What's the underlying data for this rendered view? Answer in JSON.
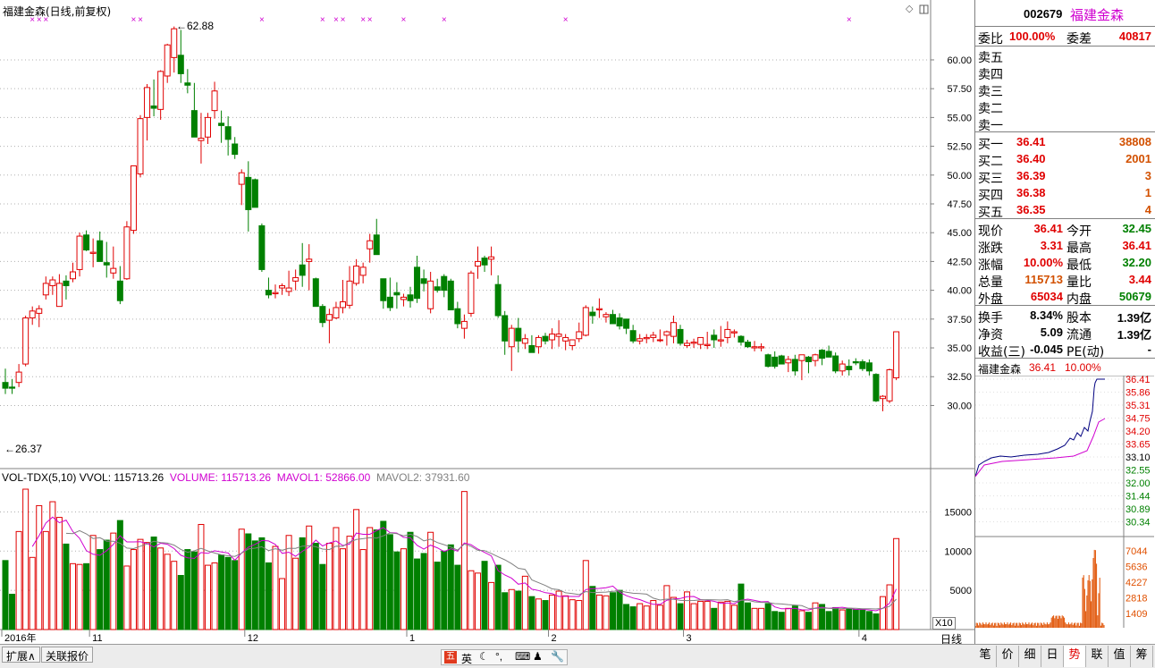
{
  "main_chart": {
    "title": "福建金森(日线,前复权)",
    "high_label": "62.88",
    "low_label": "26.37",
    "price_axis": [
      "60.00",
      "57.50",
      "55.00",
      "52.50",
      "50.00",
      "47.50",
      "45.00",
      "42.50",
      "40.00",
      "37.50",
      "35.00",
      "32.50",
      "30.00"
    ],
    "price_axis_values": [
      60.0,
      57.5,
      55.0,
      52.5,
      50.0,
      47.5,
      45.0,
      42.5,
      40.0,
      37.5,
      35.0,
      32.5,
      30.0
    ],
    "price_range": [
      25.3,
      63.8
    ],
    "corner_glyph": "◇"
  },
  "volume_chart": {
    "label_indicator": "VOL-TDX(5,10)",
    "label_vvol": "VVOL: 115713.26",
    "label_volume": "VOLUME: 115713.26",
    "label_mavol1": "MAVOL1: 52866.00",
    "label_mavol2": "MAVOL2: 37931.60",
    "axis": [
      "15000",
      "10000",
      "5000"
    ],
    "axis_values": [
      15000,
      10000,
      5000
    ],
    "unit": "X10"
  },
  "date_axis": [
    "2016年",
    "11",
    "12",
    "1",
    "2",
    "3",
    "4"
  ],
  "period_label": "日线",
  "quote": {
    "code": "002679",
    "name": "福建金森",
    "weibi_label": "委比",
    "weibi": "100.00%",
    "weicha_label": "委差",
    "weicha": "40817",
    "sells": [
      {
        "label": "卖五"
      },
      {
        "label": "卖四"
      },
      {
        "label": "卖三"
      },
      {
        "label": "卖二"
      },
      {
        "label": "卖一"
      }
    ],
    "buys": [
      {
        "label": "买一",
        "price": "36.41",
        "vol": "38808"
      },
      {
        "label": "买二",
        "price": "36.40",
        "vol": "2001"
      },
      {
        "label": "买三",
        "price": "36.39",
        "vol": "3"
      },
      {
        "label": "买四",
        "price": "36.38",
        "vol": "1"
      },
      {
        "label": "买五",
        "price": "36.35",
        "vol": "4"
      }
    ],
    "stats": [
      {
        "l1": "现价",
        "v1": "36.41",
        "c1": "red",
        "l2": "今开",
        "v2": "32.45",
        "c2": "green"
      },
      {
        "l1": "涨跌",
        "v1": "3.31",
        "c1": "red",
        "l2": "最高",
        "v2": "36.41",
        "c2": "red"
      },
      {
        "l1": "涨幅",
        "v1": "10.00%",
        "c1": "red",
        "l2": "最低",
        "v2": "32.20",
        "c2": "green"
      },
      {
        "l1": "总量",
        "v1": "115713",
        "c1": "orange",
        "l2": "量比",
        "v2": "3.44",
        "c2": "red"
      },
      {
        "l1": "外盘",
        "v1": "65034",
        "c1": "red",
        "l2": "内盘",
        "v2": "50679",
        "c2": "green"
      }
    ],
    "fund": [
      {
        "l1": "换手",
        "v1": "8.34%",
        "l2": "股本",
        "v2": "1.39亿"
      },
      {
        "l1": "净资",
        "v1": "5.09",
        "l2": "流通",
        "v2": "1.39亿"
      },
      {
        "l1": "收益(三)",
        "v1": "-0.045",
        "l2": "PE(动)",
        "v2": "-"
      }
    ]
  },
  "intraday": {
    "name": "福建金森",
    "price": "36.41",
    "pct": "10.00%",
    "price_axis": [
      "36.41",
      "35.86",
      "35.31",
      "34.75",
      "34.20",
      "33.65",
      "33.10",
      "32.55",
      "32.00",
      "31.44",
      "30.89",
      "30.34"
    ],
    "vol_axis": [
      "7044",
      "5636",
      "4227",
      "2818",
      "1409"
    ]
  },
  "toolbar": {
    "expand": "扩展∧",
    "related": "关联报价",
    "ime": "英"
  },
  "right_tabs": [
    "笔",
    "价",
    "细",
    "日",
    "势",
    "联",
    "值",
    "筹"
  ],
  "colors": {
    "up": "#e00000",
    "down": "#008000",
    "ma1": "#d000d0",
    "ma2": "#808080",
    "intraday_price": "#000080",
    "intraday_avg": "#d000d0",
    "intraday_vol": "#e05000"
  },
  "chart_data": {
    "type": "candlestick",
    "ohlc": [
      [
        32.0,
        33.2,
        31.0,
        31.5
      ],
      [
        31.6,
        32.3,
        31.0,
        31.5
      ],
      [
        32.0,
        33.6,
        31.6,
        32.9
      ],
      [
        33.6,
        37.8,
        33.4,
        37.6
      ],
      [
        37.6,
        38.6,
        37.0,
        38.2
      ],
      [
        38.0,
        38.7,
        36.8,
        38.4
      ],
      [
        39.6,
        41.2,
        39.2,
        40.6
      ],
      [
        40.4,
        41.2,
        39.6,
        40.9
      ],
      [
        38.6,
        41.4,
        38.6,
        40.6
      ],
      [
        40.8,
        41.3,
        39.2,
        40.4
      ],
      [
        41.0,
        42.4,
        40.7,
        41.6
      ],
      [
        41.8,
        45.0,
        41.2,
        44.7
      ],
      [
        44.8,
        45.2,
        43.4,
        43.5
      ],
      [
        43.2,
        44.5,
        42.0,
        43.3
      ],
      [
        44.3,
        45.1,
        42.6,
        42.5
      ],
      [
        42.4,
        44.2,
        41.1,
        42.2
      ],
      [
        41.5,
        43.8,
        41.0,
        41.9
      ],
      [
        40.8,
        42.1,
        38.8,
        39.1
      ],
      [
        41.0,
        46.0,
        40.9,
        45.5
      ],
      [
        45.2,
        50.8,
        44.9,
        50.8
      ],
      [
        50.1,
        55.2,
        49.8,
        54.9
      ],
      [
        55.0,
        57.9,
        53.0,
        57.6
      ],
      [
        56.0,
        58.3,
        55.1,
        55.8
      ],
      [
        55.7,
        59.1,
        54.8,
        59.0
      ],
      [
        58.6,
        61.4,
        58.0,
        61.3
      ],
      [
        60.2,
        62.9,
        58.9,
        62.7
      ],
      [
        60.4,
        62.6,
        58.0,
        58.8
      ],
      [
        58.0,
        59.2,
        57.1,
        57.8
      ],
      [
        55.6,
        58.0,
        54.2,
        53.3
      ],
      [
        53.0,
        55.4,
        51.0,
        53.2
      ],
      [
        53.3,
        55.4,
        52.7,
        55.0
      ],
      [
        55.6,
        58.1,
        54.9,
        57.3
      ],
      [
        54.5,
        55.6,
        52.8,
        54.3
      ],
      [
        54.2,
        55.1,
        51.7,
        53.1
      ],
      [
        52.7,
        53.3,
        51.4,
        51.8
      ],
      [
        49.2,
        50.5,
        47.4,
        50.2
      ],
      [
        49.8,
        51.2,
        45.1,
        47.0
      ],
      [
        49.6,
        49.7,
        47.3,
        47.2
      ],
      [
        45.6,
        45.8,
        41.6,
        41.8
      ],
      [
        40.0,
        41.1,
        39.3,
        39.6
      ],
      [
        39.7,
        40.5,
        39.3,
        39.8
      ],
      [
        40.2,
        40.6,
        39.6,
        40.4
      ],
      [
        39.9,
        41.7,
        39.5,
        40.2
      ],
      [
        40.8,
        41.8,
        40.0,
        41.1
      ],
      [
        42.2,
        44.1,
        40.3,
        41.3
      ],
      [
        42.5,
        44.0,
        40.0,
        42.7
      ],
      [
        41.0,
        41.1,
        38.6,
        38.6
      ],
      [
        38.6,
        38.8,
        36.8,
        37.2
      ],
      [
        37.4,
        38.4,
        35.4,
        37.9
      ],
      [
        37.6,
        39.0,
        37.5,
        38.5
      ],
      [
        38.5,
        40.9,
        38.0,
        39.0
      ],
      [
        38.7,
        42.1,
        38.4,
        40.8
      ],
      [
        40.6,
        42.7,
        40.4,
        42.1
      ],
      [
        41.3,
        42.4,
        40.6,
        42.0
      ],
      [
        43.6,
        44.9,
        42.4,
        44.3
      ],
      [
        44.8,
        46.2,
        43.4,
        43.1
      ],
      [
        41.0,
        41.0,
        38.4,
        39.1
      ],
      [
        39.4,
        41.1,
        38.2,
        38.5
      ],
      [
        39.8,
        40.7,
        38.4,
        39.6
      ],
      [
        39.2,
        39.7,
        38.6,
        39.4
      ],
      [
        39.6,
        40.3,
        38.5,
        39.1
      ],
      [
        42.0,
        43.0,
        38.9,
        39.3
      ],
      [
        41.0,
        41.8,
        39.9,
        40.6
      ],
      [
        38.4,
        41.6,
        38.0,
        40.8
      ],
      [
        40.3,
        41.0,
        39.8,
        40.0
      ],
      [
        41.2,
        41.4,
        39.4,
        40.0
      ],
      [
        40.8,
        41.0,
        38.8,
        38.3
      ],
      [
        38.4,
        39.0,
        36.7,
        37.1
      ],
      [
        36.7,
        37.9,
        35.8,
        37.3
      ],
      [
        38.0,
        41.7,
        37.7,
        41.5
      ],
      [
        42.1,
        43.8,
        41.0,
        42.5
      ],
      [
        42.8,
        43.0,
        41.6,
        42.2
      ],
      [
        42.7,
        43.8,
        41.3,
        42.9
      ],
      [
        40.5,
        41.3,
        37.6,
        37.8
      ],
      [
        37.8,
        38.2,
        34.4,
        35.6
      ],
      [
        35.1,
        37.0,
        33.0,
        36.7
      ],
      [
        36.7,
        37.6,
        34.6,
        35.6
      ],
      [
        35.4,
        36.2,
        34.9,
        35.8
      ],
      [
        35.2,
        36.1,
        34.9,
        34.6
      ],
      [
        35.1,
        36.1,
        34.5,
        35.9
      ],
      [
        36.0,
        36.3,
        35.3,
        35.6
      ],
      [
        35.7,
        36.7,
        34.9,
        36.2
      ],
      [
        36.0,
        37.4,
        35.1,
        36.2
      ],
      [
        35.6,
        36.2,
        34.8,
        35.9
      ],
      [
        35.2,
        35.6,
        34.8,
        35.7
      ],
      [
        35.8,
        37.2,
        35.5,
        36.4
      ],
      [
        36.1,
        38.7,
        36.0,
        38.5
      ],
      [
        38.1,
        38.6,
        37.1,
        37.8
      ],
      [
        38.3,
        39.3,
        37.6,
        38.4
      ],
      [
        37.7,
        38.1,
        37.2,
        37.9
      ],
      [
        37.9,
        38.3,
        37.1,
        37.1
      ],
      [
        37.6,
        38.0,
        36.6,
        36.9
      ],
      [
        37.5,
        37.5,
        36.2,
        36.7
      ],
      [
        36.5,
        37.0,
        35.4,
        35.6
      ],
      [
        35.6,
        36.2,
        35.3,
        35.8
      ],
      [
        35.8,
        36.2,
        35.4,
        35.9
      ],
      [
        35.9,
        36.4,
        35.5,
        36.1
      ],
      [
        35.7,
        36.6,
        35.5,
        35.7
      ],
      [
        36.1,
        36.5,
        35.2,
        36.4
      ],
      [
        36.0,
        37.8,
        35.4,
        37.2
      ],
      [
        36.6,
        37.0,
        35.2,
        35.4
      ],
      [
        35.2,
        35.7,
        35.0,
        35.4
      ],
      [
        35.4,
        35.8,
        35.0,
        35.5
      ],
      [
        35.3,
        35.6,
        34.9,
        35.9
      ],
      [
        35.2,
        36.4,
        34.9,
        35.3
      ],
      [
        36.1,
        36.6,
        35.0,
        35.7
      ],
      [
        35.6,
        36.9,
        35.1,
        35.7
      ],
      [
        35.9,
        37.3,
        35.4,
        36.6
      ],
      [
        36.3,
        36.6,
        35.9,
        36.4
      ],
      [
        36.0,
        36.1,
        35.2,
        35.5
      ],
      [
        35.5,
        35.7,
        35.0,
        35.1
      ],
      [
        35.0,
        35.6,
        34.7,
        35.1
      ],
      [
        35.0,
        35.4,
        34.7,
        35.1
      ],
      [
        34.4,
        34.5,
        33.3,
        33.4
      ],
      [
        34.2,
        34.7,
        33.2,
        33.4
      ],
      [
        34.3,
        34.4,
        33.6,
        33.6
      ],
      [
        33.7,
        34.3,
        32.9,
        34.0
      ],
      [
        34.0,
        34.4,
        32.6,
        33.0
      ],
      [
        33.9,
        34.2,
        32.2,
        34.4
      ],
      [
        34.2,
        34.3,
        32.8,
        33.8
      ],
      [
        33.9,
        34.5,
        33.4,
        34.4
      ],
      [
        34.8,
        34.9,
        33.5,
        34.1
      ],
      [
        34.7,
        35.2,
        34.2,
        34.2
      ],
      [
        34.3,
        34.6,
        32.8,
        33.0
      ],
      [
        33.0,
        33.9,
        32.6,
        33.6
      ],
      [
        33.4,
        34.0,
        32.6,
        33.1
      ],
      [
        33.8,
        34.1,
        33.5,
        33.7
      ],
      [
        33.8,
        34.0,
        33.0,
        33.2
      ],
      [
        33.7,
        34.0,
        32.6,
        33.0
      ],
      [
        32.7,
        32.8,
        30.3,
        30.4
      ],
      [
        30.6,
        30.9,
        29.5,
        30.8
      ],
      [
        30.4,
        33.2,
        30.2,
        33.1
      ],
      [
        32.4,
        36.4,
        32.2,
        36.4
      ]
    ],
    "volume": [
      8800,
      4500,
      12500,
      17900,
      9200,
      15800,
      12500,
      16300,
      14300,
      10900,
      8400,
      8300,
      8400,
      12000,
      10200,
      11400,
      12300,
      13900,
      8100,
      10200,
      11500,
      11100,
      11800,
      10400,
      9600,
      8700,
      6900,
      10200,
      9900,
      13400,
      8200,
      8500,
      9500,
      9200,
      8800,
      12800,
      12200,
      11300,
      11700,
      8500,
      10600,
      6500,
      12000,
      9100,
      11700,
      13200,
      11000,
      8300,
      11000,
      13000,
      10300,
      11900,
      15300,
      10200,
      13000,
      12700,
      13800,
      12100,
      9900,
      10300,
      12400,
      9000,
      9700,
      12400,
      8600,
      10000,
      10800,
      8200,
      17600,
      7500,
      7200,
      8700,
      6000,
      8200,
      4700,
      5100,
      4900,
      6800,
      4200,
      3900,
      3700,
      4400,
      4900,
      4300,
      3800,
      3700,
      8800,
      5500,
      4400,
      4300,
      4700,
      5000,
      3200,
      2900,
      3300,
      3000,
      3700,
      3100,
      5600,
      4100,
      3300,
      4800,
      3300,
      3600,
      3600,
      2700,
      3500,
      3600,
      3100,
      5800,
      3400,
      2700,
      2700,
      3300,
      2300,
      2200,
      2700,
      3000,
      2400,
      2200,
      3400,
      3200,
      2300,
      2800,
      2500,
      2700,
      2500,
      2500,
      2300,
      2000,
      4200,
      5700,
      11600
    ],
    "up_days_red": true,
    "x_dates": [
      "2016年",
      "11",
      "12",
      "1",
      "2",
      "3",
      "4"
    ],
    "y_range": [
      25.3,
      63.8
    ]
  }
}
